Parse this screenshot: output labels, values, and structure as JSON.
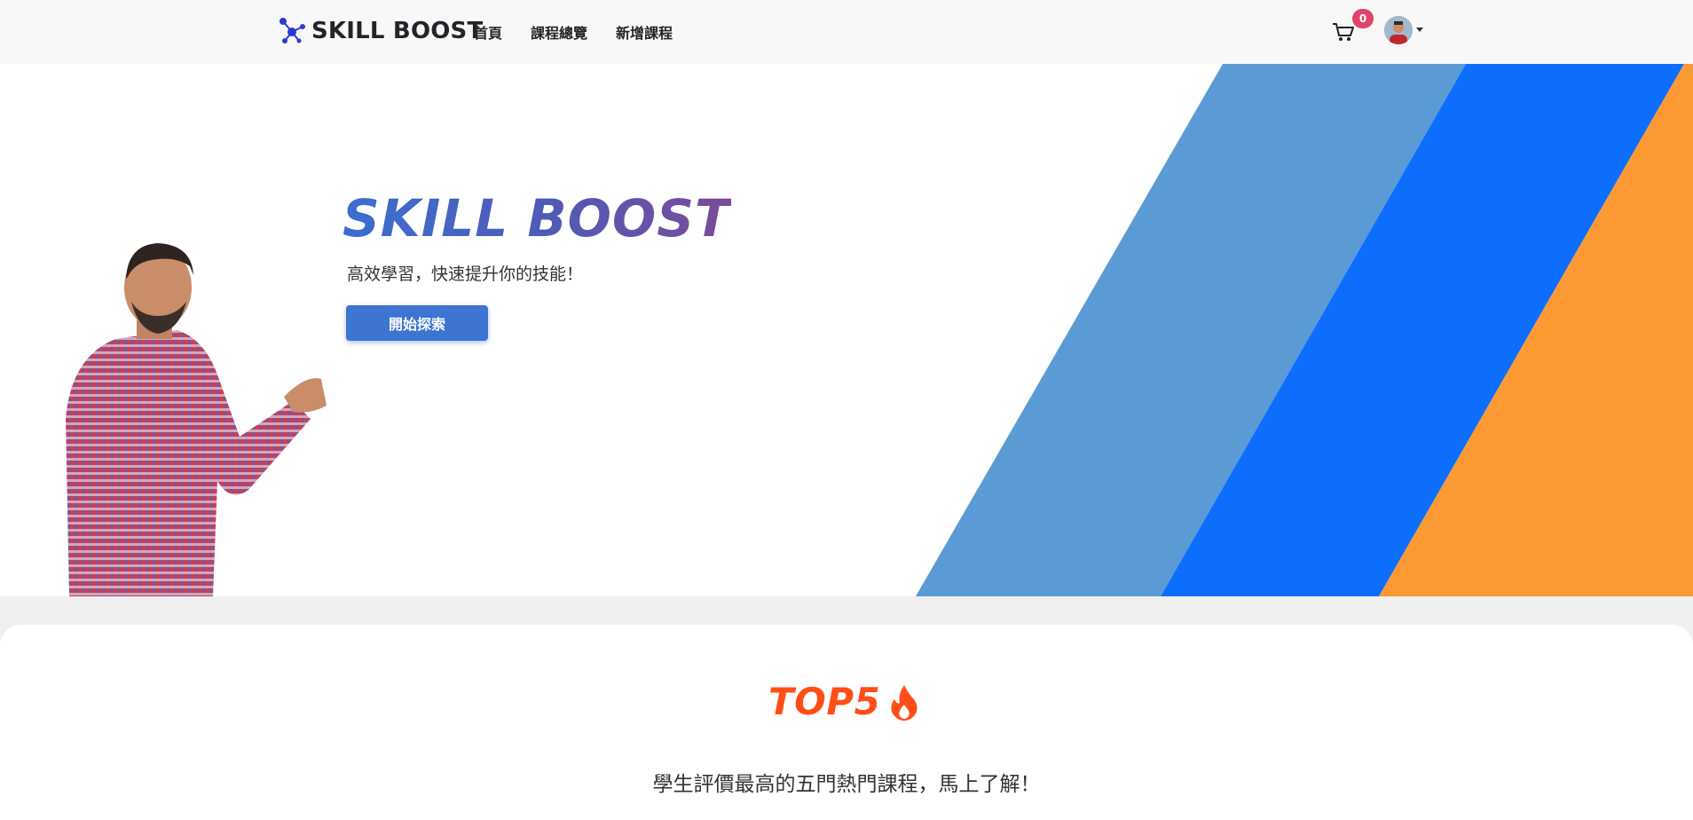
{
  "navbar": {
    "brand": "SKILL BOOST",
    "links": [
      "首頁",
      "課程總覽",
      "新增課程"
    ],
    "cart_count": "0"
  },
  "hero": {
    "title": "SKILL BOOST",
    "subtitle": "高效學習，快速提升你的技能！",
    "cta_label": "開始探索"
  },
  "top5": {
    "title": "TOP5",
    "subtitle": "學生評價最高的五門熱門課程，馬上了解！"
  },
  "colors": {
    "stripe_light_blue": "#5b9bd5",
    "stripe_blue": "#0d6efd",
    "stripe_orange": "#fd9933",
    "accent_button": "#3d73d1",
    "badge": "#e0446a",
    "top5_orange": "#ff4e17"
  },
  "icons": [
    "network-logo-icon",
    "cart-icon",
    "avatar",
    "caret-down-icon",
    "fire-icon"
  ]
}
